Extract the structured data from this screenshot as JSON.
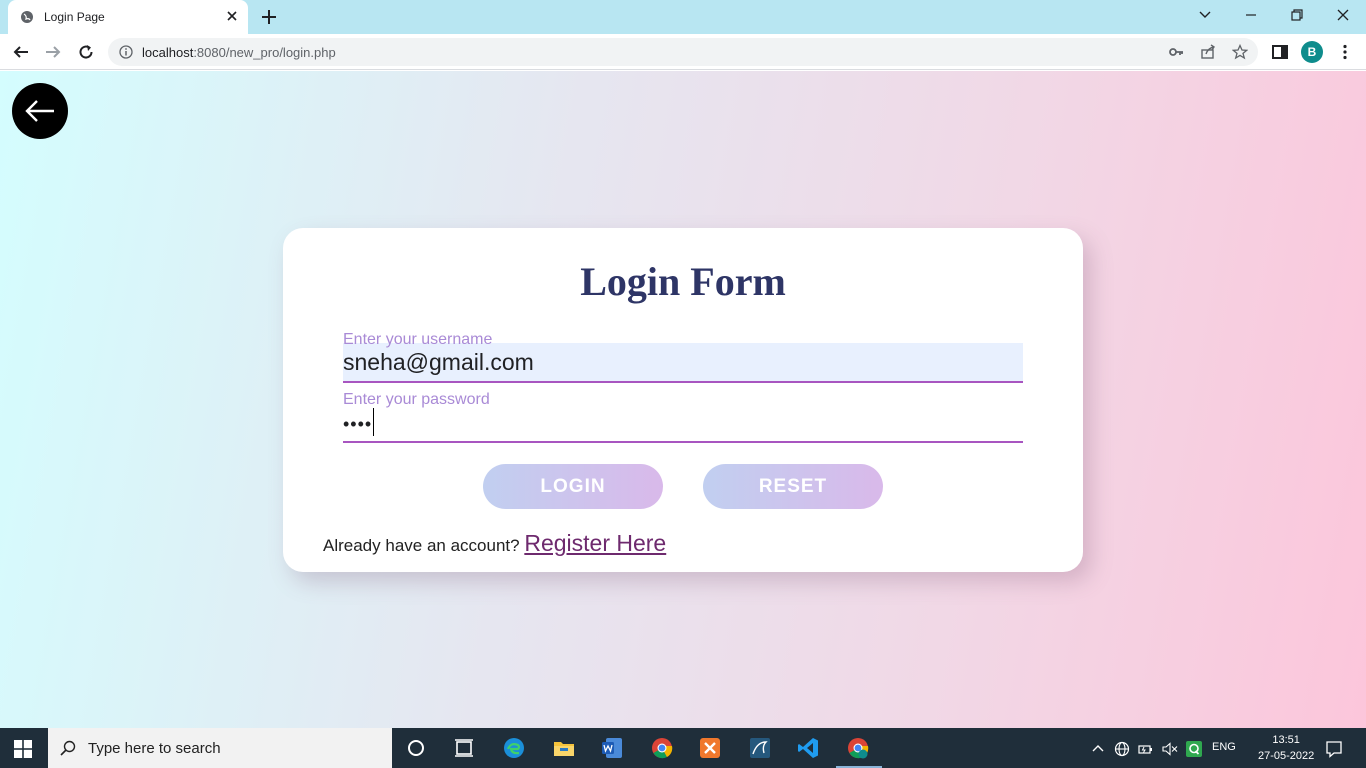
{
  "browser": {
    "tab_title": "Login Page",
    "url_host": "localhost",
    "url_rest": ":8080/new_pro/login.php",
    "profile_initial": "B"
  },
  "form": {
    "title": "Login Form",
    "username_label": "Enter your username",
    "username_value": "sneha@gmail.com",
    "password_label": "Enter your password",
    "password_value": "••••",
    "login_label": "LOGIN",
    "reset_label": "RESET",
    "register_prompt": "Already have an account?",
    "register_link": "Register Here"
  },
  "taskbar": {
    "search_placeholder": "Type here to search",
    "language": "ENG",
    "time": "13:51",
    "date": "27-05-2022"
  },
  "colors": {
    "title": "#2e3566",
    "accent_underline": "#a855c0",
    "label": "#a98ad6",
    "link": "#6e2a6e",
    "tabstrip": "#b8e6f2",
    "taskbar": "#1f2e3a"
  }
}
